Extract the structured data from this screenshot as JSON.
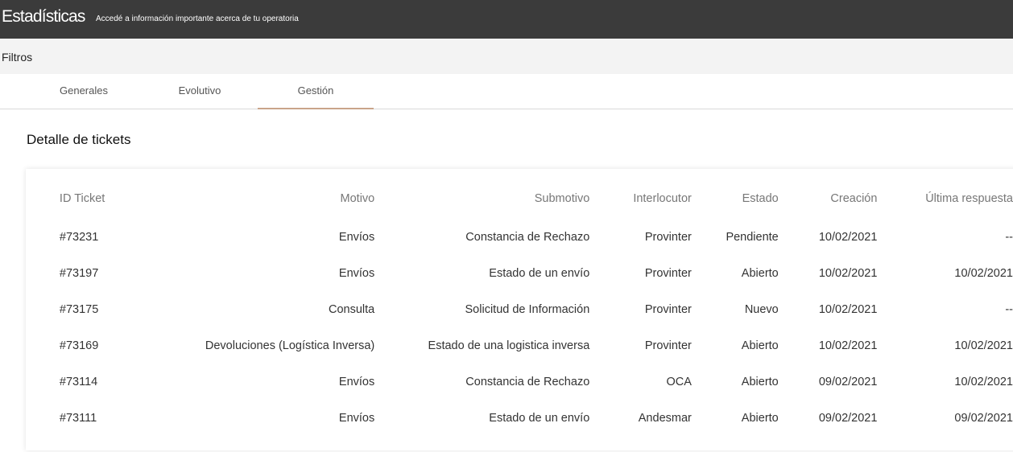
{
  "header": {
    "title": "Estadísticas",
    "subtitle": "Accedé a información importante acerca de tu operatoria"
  },
  "filters": {
    "label": "Filtros"
  },
  "tabs": [
    {
      "label": "Generales",
      "active": false
    },
    {
      "label": "Evolutivo",
      "active": false
    },
    {
      "label": "Gestión",
      "active": true
    }
  ],
  "section": {
    "title": "Detalle de tickets"
  },
  "table": {
    "headers": [
      "ID Ticket",
      "Motivo",
      "Submotivo",
      "Interlocutor",
      "Estado",
      "Creación",
      "Última respuesta"
    ],
    "rows": [
      [
        "#73231",
        "Envíos",
        "Constancia de Rechazo",
        "Provinter",
        "Pendiente",
        "10/02/2021",
        "--"
      ],
      [
        "#73197",
        "Envíos",
        "Estado de un envío",
        "Provinter",
        "Abierto",
        "10/02/2021",
        "10/02/2021"
      ],
      [
        "#73175",
        "Consulta",
        "Solicitud de Información",
        "Provinter",
        "Nuevo",
        "10/02/2021",
        "--"
      ],
      [
        "#73169",
        "Devoluciones (Logística Inversa)",
        "Estado de una logistica inversa",
        "Provinter",
        "Abierto",
        "10/02/2021",
        "10/02/2021"
      ],
      [
        "#73114",
        "Envíos",
        "Constancia de Rechazo",
        "OCA",
        "Abierto",
        "09/02/2021",
        "10/02/2021"
      ],
      [
        "#73111",
        "Envíos",
        "Estado de un envío",
        "Andesmar",
        "Abierto",
        "09/02/2021",
        "09/02/2021"
      ]
    ]
  },
  "colors": {
    "header_bg": "#3b3b3b",
    "filters_bg": "#f3f3f3",
    "active_tab_underline": "#c9a48a"
  }
}
